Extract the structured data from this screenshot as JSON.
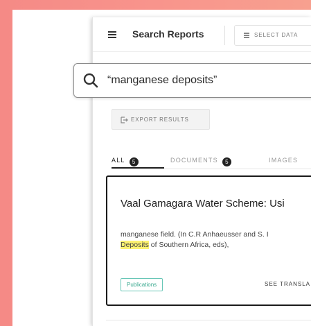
{
  "header": {
    "title": "Search Reports",
    "select_data_label": "SELECT DATA"
  },
  "search": {
    "query": "“manganese deposits”"
  },
  "export": {
    "label": "EXPORT RESULTS"
  },
  "tabs": [
    {
      "label": "ALL",
      "count": "5",
      "active": true
    },
    {
      "label": "DOCUMENTS",
      "count": "5",
      "active": false
    },
    {
      "label": "IMAGES",
      "active": false
    }
  ],
  "result": {
    "title": "Vaal Gamagara Water Scheme: Usi",
    "snippet_line1": "manganese field. (In C.R Anhaeusser and S. I",
    "snippet_highlight": "Deposits",
    "snippet_line2_rest": " of Southern Africa, eds),",
    "tag": "Publications",
    "see_translation": "SEE TRANSLA"
  },
  "colors": {
    "background_gradient_start": "#f58a86",
    "background_gradient_end": "#f7a08f",
    "highlight": "#fdf170",
    "tag_accent": "#3aa98f"
  },
  "icons": [
    "menu-icon",
    "database-icon",
    "search-icon",
    "export-icon"
  ]
}
